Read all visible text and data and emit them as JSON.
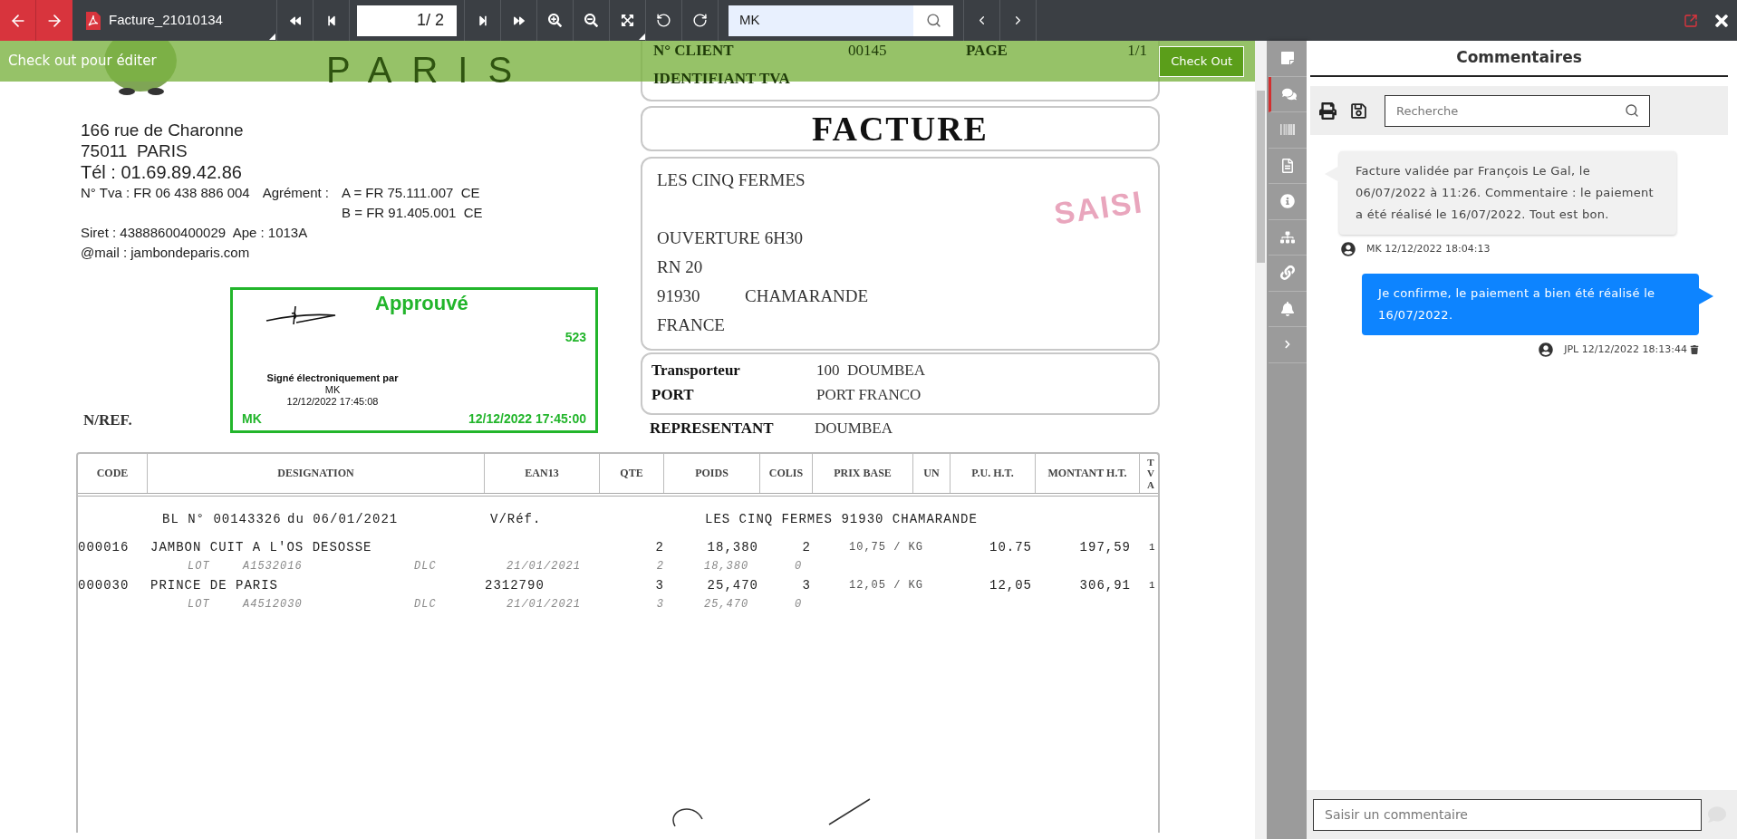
{
  "toolbar": {
    "document_title": "Facture_21010134",
    "page_field": {
      "value": "1/ 2"
    },
    "search_field": {
      "value": "MK"
    }
  },
  "banner": {
    "message": "Check out pour éditer",
    "button": "Check Out"
  },
  "document": {
    "logo_text": "PARIS",
    "client_header": {
      "client_label": "N° CLIENT",
      "client_number": "00145",
      "page_label": "PAGE",
      "page_value": "1/1",
      "vat_label": "IDENTIFIANT TVA"
    },
    "address": [
      "166 rue de Charonne",
      "75011  PARIS",
      "Tél : 01.69.89.42.86"
    ],
    "vat_line": "N° Tva : FR 06 438 886 004",
    "agrement_label": "Agrément :",
    "agrement_values": [
      "A = FR 75.111.007  CE",
      "B = FR 91.405.001  CE"
    ],
    "siret": "Siret : 43888600400029  Ape : 1013A",
    "email": "@mail : jambondeparis.com",
    "title": "FACTURE",
    "recipient": {
      "name": "LES CINQ FERMES",
      "lines": [
        "OUVERTURE 6H30",
        "RN 20"
      ],
      "postcode": "91930",
      "city": "CHAMARANDE",
      "country": "FRANCE",
      "stamp": "SAISI"
    },
    "transport": [
      {
        "label": "Transporteur",
        "value": "100  DOUMBEA"
      },
      {
        "label": "PORT",
        "value": "PORT FRANCO"
      }
    ],
    "representative": {
      "label": "REPRESENTANT",
      "value": "DOUMBEA"
    },
    "approval_stamp": {
      "title": "Approuvé",
      "number": "523",
      "signed_lines": [
        "Signé électroniquement par",
        "MK",
        "12/12/2022 17:45:08"
      ],
      "user": "MK",
      "date": "12/12/2022 17:45:00"
    },
    "ref_label": "N/REF.",
    "table": {
      "columns": [
        "CODE",
        "DESIGNATION",
        "EAN13",
        "QTE",
        "POIDS",
        "COLIS",
        "PRIX BASE",
        "UN",
        "P.U. H.T.",
        "MONTANT H.T.",
        "TVA"
      ],
      "delivery_line": [
        "BL N° 00143326",
        "du 06/01/2021",
        "V/Réf.",
        "LES CINQ FERMES 91930 CHAMARANDE"
      ],
      "rows": [
        {
          "code": "000016",
          "designation": "JAMBON CUIT A L'OS DESOSSE",
          "qte": "2",
          "poids": "18,380",
          "colis": "2",
          "prix_base": "10,75 / KG",
          "pu": "10.75",
          "montant": "197,59",
          "tva": "1",
          "lot": {
            "label": "LOT",
            "number": "A1532016",
            "dlc_label": "DLC",
            "dlc": "21/01/2021",
            "qte": "2",
            "poids": "18,380",
            "colis": "0"
          }
        },
        {
          "code": "000030",
          "designation": "PRINCE DE PARIS",
          "ean": "2312790",
          "qte": "3",
          "poids": "25,470",
          "colis": "3",
          "prix_base": "12,05 / KG",
          "pu": "12,05",
          "montant": "306,91",
          "tva": "1",
          "lot": {
            "label": "LOT",
            "number": "A4512030",
            "dlc_label": "DLC",
            "dlc": "21/01/2021",
            "qte": "3",
            "poids": "25,470",
            "colis": "0"
          }
        }
      ]
    }
  },
  "side_rail": {
    "items": [
      {
        "kind": "note",
        "selected": false
      },
      {
        "kind": "comments",
        "selected": true
      },
      {
        "kind": "barcode",
        "selected": false
      },
      {
        "kind": "document",
        "selected": false
      },
      {
        "kind": "info",
        "selected": false
      },
      {
        "kind": "hierarchy",
        "selected": false
      },
      {
        "kind": "link",
        "selected": false
      },
      {
        "kind": "bell",
        "selected": false
      },
      {
        "kind": "expand",
        "selected": false
      }
    ]
  },
  "comments_panel": {
    "title": "Commentaires",
    "search": {
      "placeholder": "Recherche"
    },
    "comments": [
      {
        "text": "Facture validée par François Le Gal, le 06/07/2022 à 11:26. Commentaire : le paiement a été réalisé le 16/07/2022. Tout est bon.",
        "meta": "MK 12/12/2022 18:04:13",
        "own": false
      },
      {
        "text": "Je confirme, le paiement a bien été réalisé le 16/07/2022.",
        "meta": "JPL 12/12/2022 18:13:44",
        "own": true
      }
    ],
    "input": {
      "placeholder": "Saisir un commentaire"
    }
  }
}
